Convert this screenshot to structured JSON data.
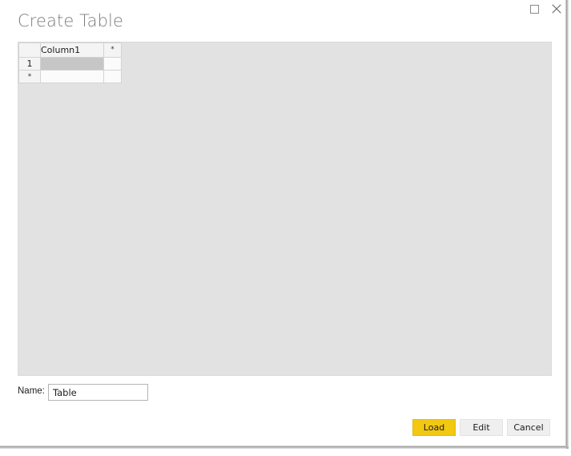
{
  "window": {
    "title": "Create Table",
    "controls": [
      {
        "name": "maximize",
        "label": "Maximize",
        "glyph": "square"
      },
      {
        "name": "close",
        "label": "Close",
        "glyph": "x"
      }
    ]
  },
  "grid": {
    "columns": [
      {
        "key": "rowheader",
        "label": ""
      },
      {
        "key": "column1",
        "label": "Column1"
      },
      {
        "key": "newcolumn",
        "label": "*"
      }
    ],
    "rows": [
      {
        "header": "1",
        "column1": "",
        "newcolumn": "",
        "selected": true
      },
      {
        "header": "*",
        "column1": "",
        "newcolumn": "",
        "selected": false
      }
    ]
  },
  "name_field": {
    "label": "Name:",
    "value": "Table",
    "placeholder": ""
  },
  "footer": {
    "load_label": "Load",
    "edit_label": "Edit",
    "cancel_label": "Cancel"
  },
  "colors": {
    "accent": "#F2C811",
    "panel_background": "#E2E2E2",
    "title_text": "#7C7C7C",
    "selected_cell": "#C6C6C6"
  }
}
